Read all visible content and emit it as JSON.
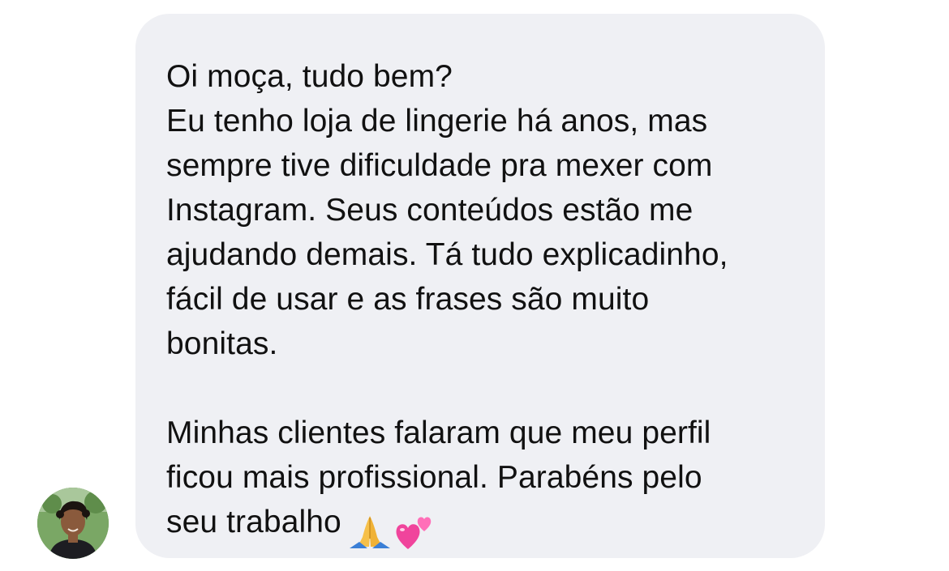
{
  "conversation": {
    "sender_avatar": {
      "icon": "profile-photo-icon"
    },
    "message": {
      "lines": [
        "Oi moça, tudo bem?",
        "Eu tenho loja de lingerie há anos, mas",
        "sempre tive dificuldade pra mexer com",
        "Instagram. Seus conteúdos estão me",
        "ajudando demais. Tá tudo explicadinho,",
        "fácil de usar e as frases são muito",
        "bonitas.",
        "Minhas clientes falaram que meu perfil",
        "ficou mais profissional. Parabéns pelo",
        "seu trabalho"
      ],
      "emojis": [
        "folded-hands-icon",
        "two-hearts-icon"
      ]
    },
    "colors": {
      "bubble_background": "#eff0f4",
      "text": "#111111",
      "page_background": "#ffffff"
    }
  }
}
